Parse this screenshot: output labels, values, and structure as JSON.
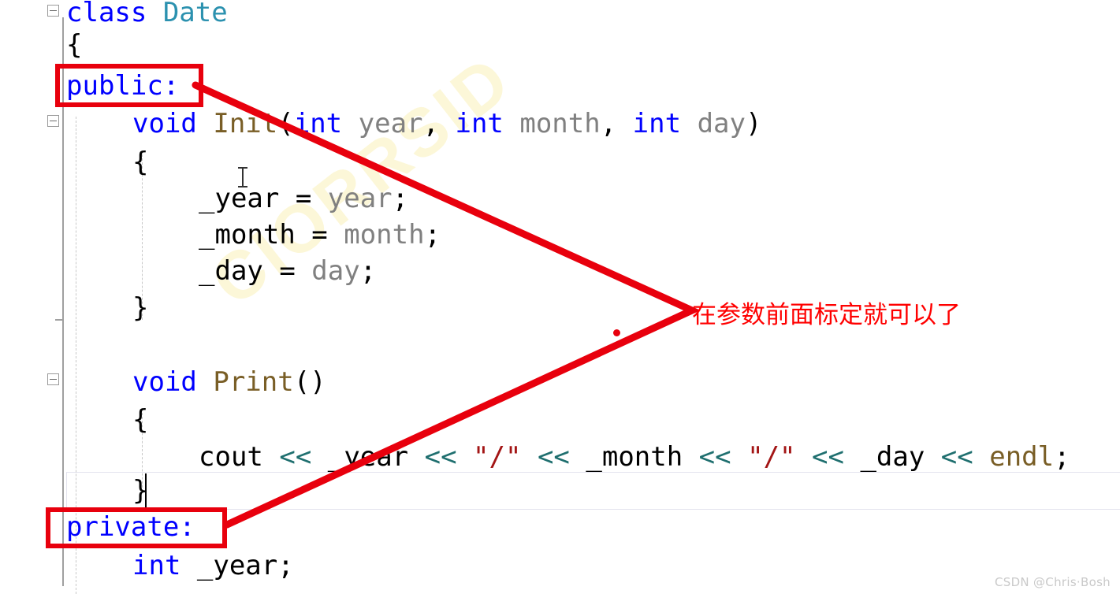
{
  "editor": {
    "language": "cpp",
    "background_color": "#ffffff",
    "lines": [
      {
        "id": "line-class-date",
        "indent": 0,
        "tokens": [
          {
            "text": "class ",
            "kind": "kw"
          },
          {
            "text": "Date",
            "kind": "type"
          }
        ]
      },
      {
        "id": "line-open-brace-class",
        "indent": 0,
        "tokens": [
          {
            "text": "{",
            "kind": "plain"
          }
        ]
      },
      {
        "id": "line-public",
        "indent": 0,
        "tokens": [
          {
            "text": "public:",
            "kind": "kw"
          }
        ]
      },
      {
        "id": "line-init-signature",
        "indent": 1,
        "tokens": [
          {
            "text": "void ",
            "kind": "kw"
          },
          {
            "text": "Init",
            "kind": "fn"
          },
          {
            "text": "(",
            "kind": "plain"
          },
          {
            "text": "int ",
            "kind": "kw"
          },
          {
            "text": "year",
            "kind": "param"
          },
          {
            "text": ", ",
            "kind": "plain"
          },
          {
            "text": "int ",
            "kind": "kw"
          },
          {
            "text": "month",
            "kind": "param"
          },
          {
            "text": ", ",
            "kind": "plain"
          },
          {
            "text": "int ",
            "kind": "kw"
          },
          {
            "text": "day",
            "kind": "param"
          },
          {
            "text": ")",
            "kind": "plain"
          }
        ]
      },
      {
        "id": "line-init-open",
        "indent": 1,
        "tokens": [
          {
            "text": "{",
            "kind": "plain"
          }
        ]
      },
      {
        "id": "line-assign-year",
        "indent": 2,
        "tokens": [
          {
            "text": "_year = ",
            "kind": "plain"
          },
          {
            "text": "year",
            "kind": "param"
          },
          {
            "text": ";",
            "kind": "plain"
          }
        ]
      },
      {
        "id": "line-assign-month",
        "indent": 2,
        "tokens": [
          {
            "text": "_month = ",
            "kind": "plain"
          },
          {
            "text": "month",
            "kind": "param"
          },
          {
            "text": ";",
            "kind": "plain"
          }
        ]
      },
      {
        "id": "line-assign-day",
        "indent": 2,
        "tokens": [
          {
            "text": "_day = ",
            "kind": "plain"
          },
          {
            "text": "day",
            "kind": "param"
          },
          {
            "text": ";",
            "kind": "plain"
          }
        ]
      },
      {
        "id": "line-init-close",
        "indent": 1,
        "tokens": [
          {
            "text": "}",
            "kind": "plain"
          }
        ]
      },
      {
        "id": "line-blank",
        "indent": 0,
        "tokens": [
          {
            "text": "",
            "kind": "plain"
          }
        ]
      },
      {
        "id": "line-print-signature",
        "indent": 1,
        "tokens": [
          {
            "text": "void ",
            "kind": "kw"
          },
          {
            "text": "Print",
            "kind": "fn"
          },
          {
            "text": "()",
            "kind": "plain"
          }
        ]
      },
      {
        "id": "line-print-open",
        "indent": 1,
        "tokens": [
          {
            "text": "{",
            "kind": "plain"
          }
        ]
      },
      {
        "id": "line-cout",
        "indent": 2,
        "tokens": [
          {
            "text": "cout ",
            "kind": "plain"
          },
          {
            "text": "<<",
            "kind": "op"
          },
          {
            "text": " _year ",
            "kind": "plain"
          },
          {
            "text": "<<",
            "kind": "op"
          },
          {
            "text": " ",
            "kind": "plain"
          },
          {
            "text": "\"/\"",
            "kind": "str"
          },
          {
            "text": " ",
            "kind": "plain"
          },
          {
            "text": "<<",
            "kind": "op"
          },
          {
            "text": " _month ",
            "kind": "plain"
          },
          {
            "text": "<<",
            "kind": "op"
          },
          {
            "text": " ",
            "kind": "plain"
          },
          {
            "text": "\"/\"",
            "kind": "str"
          },
          {
            "text": " ",
            "kind": "plain"
          },
          {
            "text": "<<",
            "kind": "op"
          },
          {
            "text": " _day ",
            "kind": "plain"
          },
          {
            "text": "<<",
            "kind": "op"
          },
          {
            "text": " ",
            "kind": "plain"
          },
          {
            "text": "endl",
            "kind": "fn"
          },
          {
            "text": ";",
            "kind": "plain"
          }
        ]
      },
      {
        "id": "line-print-close",
        "indent": 1,
        "tokens": [
          {
            "text": "}",
            "kind": "plain"
          }
        ]
      },
      {
        "id": "line-private",
        "indent": 0,
        "tokens": [
          {
            "text": "private:",
            "kind": "kw"
          }
        ]
      },
      {
        "id": "line-member-year",
        "indent": 1,
        "tokens": [
          {
            "text": "int ",
            "kind": "kw"
          },
          {
            "text": "_year;",
            "kind": "plain"
          }
        ]
      }
    ],
    "caret": {
      "line_id": "line-print-close"
    },
    "current_line_id": "line-print-close",
    "background_watermark": "CIORRSID"
  },
  "annotation": {
    "color": "#e8000d",
    "text_color": "#ff0000",
    "note_text": "在参数前面标定就可以了",
    "boxes": [
      {
        "id": "highlight-public",
        "label": "public:"
      },
      {
        "id": "highlight-private",
        "label": "private:"
      }
    ],
    "arrow_description": "red v-shaped pointer line"
  },
  "watermark": {
    "text": "CSDN @Chris·Bosh"
  }
}
